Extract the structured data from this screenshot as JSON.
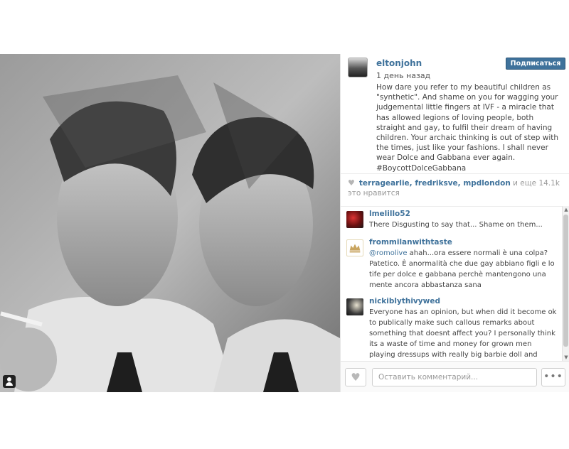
{
  "post": {
    "username": "eltonjohn",
    "time_ago": "1 день назад",
    "follow_label": "Подписаться",
    "caption": "How dare you refer to my beautiful children as \"synthetic\". And shame on you for wagging your judgemental little fingers at IVF - a miracle that has allowed legions of loving people, both straight and gay, to fulfil their dream of having children. Your archaic thinking is out of step with the times, just like your fashions. I shall never wear Dolce and Gabbana ever again. #BoycottDolceGabbana"
  },
  "likes": {
    "heart_icon": "heart-icon",
    "likers": "terragearlie, fredriksve, mpdlondon",
    "rest": " и еще 14.1k это нравится"
  },
  "comments": [
    {
      "user": "lmelillo52",
      "mention": "",
      "text": "There Disgusting to say that... Shame on them..."
    },
    {
      "user": "frommilanwithtaste",
      "mention": "@romolive",
      "text": " ahah...ora essere normali è una colpa? Patetico. È anormalità che due gay abbiano figli e lo tife per dolce e gabbana perchè mantengono una mente ancora abbastanza sana"
    },
    {
      "user": "nickiblythivywed",
      "mention": "",
      "text": "Everyone has an opinion, but when did it become ok to publically make such callous remarks about something that doesnt affect you? I personally think its a waste of time and money for grown men playing dressups with really big barbie doll and doing nothing"
    }
  ],
  "footer": {
    "comment_placeholder": "Оставить комментарий...",
    "more_label": "•••"
  },
  "colors": {
    "link": "#3f729b",
    "text": "#444444",
    "muted": "#9a9a9a"
  }
}
